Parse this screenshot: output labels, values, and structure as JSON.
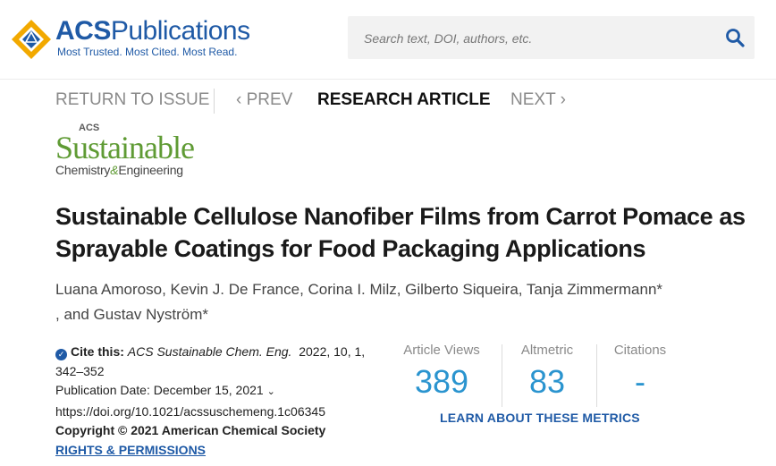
{
  "header": {
    "brand_name_bold": "ACS",
    "brand_name_rest": "Publications",
    "tagline": "Most Trusted. Most Cited. Most Read.",
    "search_placeholder": "Search text, DOI, authors, etc."
  },
  "nav": {
    "return": "RETURN TO ISSUE",
    "prev": "‹ PREV",
    "current": "RESEARCH ARTICLE",
    "next": "NEXT ›"
  },
  "journal": {
    "acs": "ACS",
    "name": "Sustainable",
    "sub_a": "Chemistry",
    "sub_amp": "&",
    "sub_b": "Engineering"
  },
  "article": {
    "title": "Sustainable Cellulose Nanofiber Films from Carrot Pomace as Sprayable Coatings for Food Packaging Applications",
    "authors_line1": "Luana Amoroso, Kevin J. De France, Corina I. Milz, Gilberto Siqueira, Tanja Zimmermann*",
    "authors_line2": ", and Gustav Nyström*"
  },
  "meta": {
    "cite_label": "Cite this:",
    "journal_abbrev": "ACS Sustainable Chem. Eng.",
    "citation_details": "2022, 10, 1,",
    "pages": "342–352",
    "pub_date": "Publication Date: December 15, 2021",
    "doi": "https://doi.org/10.1021/acssuschemeng.1c06345",
    "copyright": "Copyright © 2021 American Chemical Society",
    "rights": "RIGHTS & PERMISSIONS"
  },
  "metrics": {
    "views_label": "Article Views",
    "views_value": "389",
    "altmetric_label": "Altmetric",
    "altmetric_value": "83",
    "citations_label": "Citations",
    "citations_value": "-",
    "learn_more": "LEARN ABOUT THESE METRICS"
  },
  "colors": {
    "brand_blue": "#1f5aa6",
    "metric_blue": "#2a94cf",
    "journal_green": "#5f9b34",
    "logo_gold": "#f2a900"
  }
}
